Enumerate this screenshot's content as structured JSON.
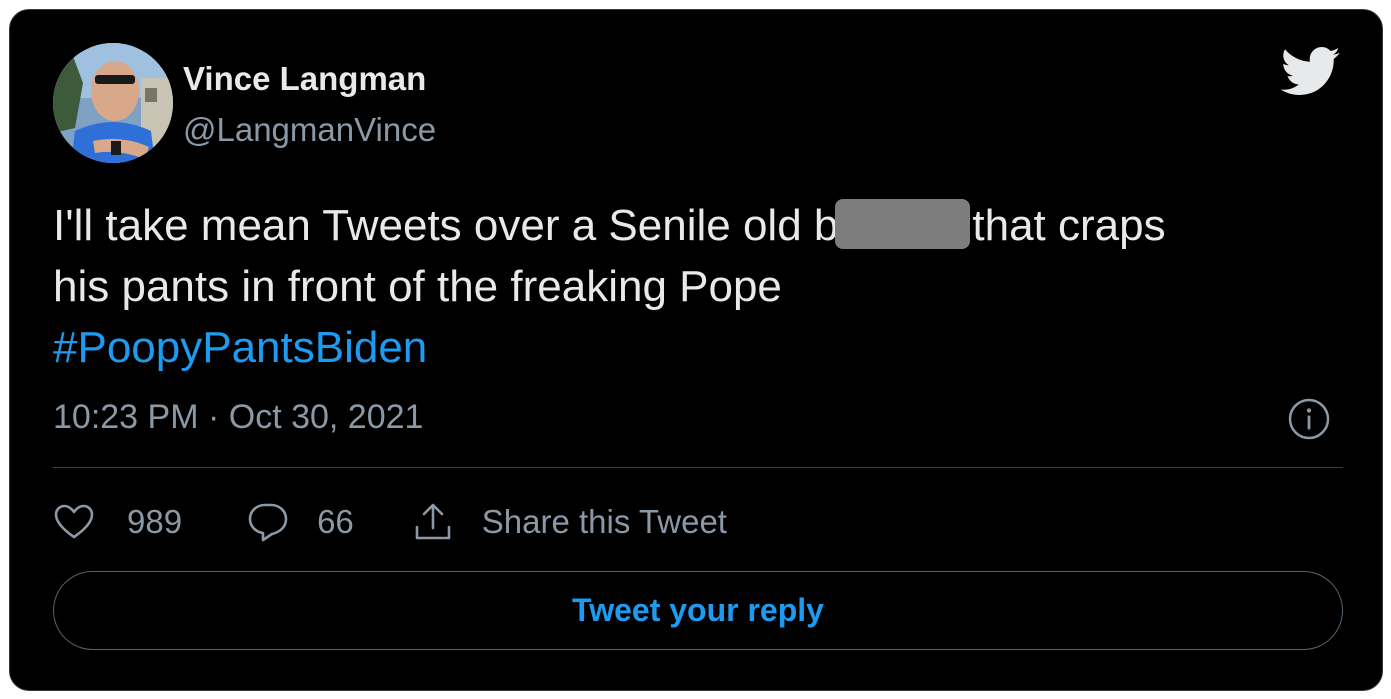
{
  "tweet": {
    "author": {
      "display_name": "Vince Langman",
      "handle": "@LangmanVince"
    },
    "text_lines": [
      {
        "before_redaction": "I'll take mean Tweets over a Senile old b",
        "after_redaction": "that craps"
      },
      {
        "text": "his pants in front of the freaking Pope"
      }
    ],
    "hashtag": "#PoopyPantsBiden",
    "timestamp": "10:23 PM · Oct 30, 2021",
    "likes": "989",
    "replies": "66",
    "share_label": "Share this Tweet",
    "reply_button_label": "Tweet your reply"
  },
  "icons": {
    "brand": "twitter-bird-icon",
    "info": "info-icon",
    "like": "heart-icon",
    "reply": "speech-bubble-icon",
    "share": "share-upload-icon"
  },
  "colors": {
    "background": "#000000",
    "text": "#e7e9ea",
    "secondary_text": "#8b98a5",
    "accent": "#1d9bf0",
    "redaction": "#7d7d7d"
  }
}
